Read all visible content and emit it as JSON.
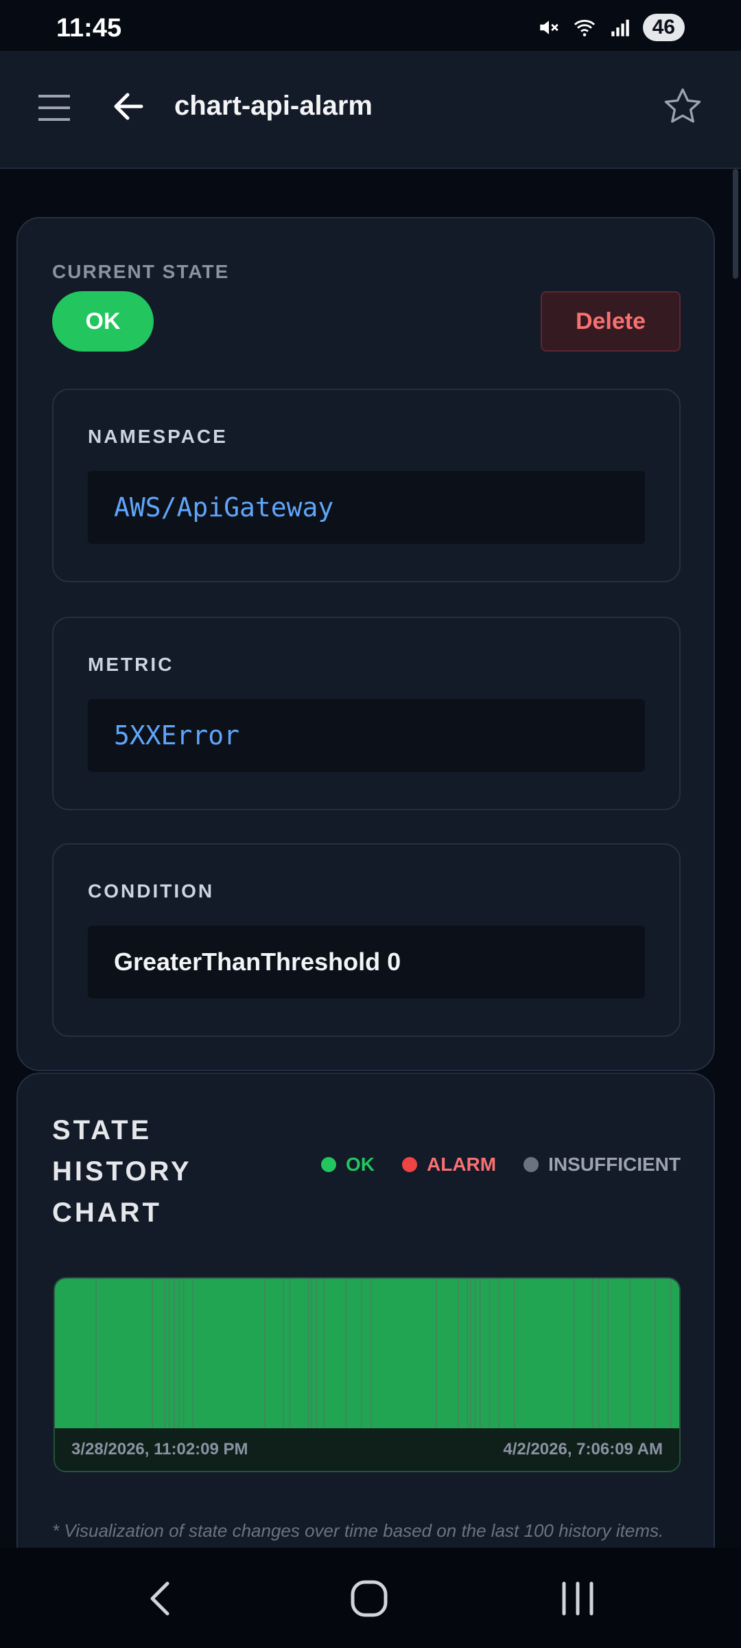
{
  "status_bar": {
    "time": "11:45",
    "battery": "46"
  },
  "app_bar": {
    "title": "chart-api-alarm"
  },
  "state_card": {
    "current_state_label": "CURRENT STATE",
    "state_value": "OK",
    "delete_label": "Delete",
    "fields": [
      {
        "label": "NAMESPACE",
        "value": "AWS/ApiGateway"
      },
      {
        "label": "METRIC",
        "value": "5XXError"
      },
      {
        "label": "CONDITION",
        "value": "GreaterThanThreshold 0"
      }
    ]
  },
  "chart_card": {
    "title": "STATE HISTORY CHART",
    "legend": [
      {
        "label": "OK",
        "color": "#22c55e"
      },
      {
        "label": "ALARM",
        "color": "#ef4444"
      },
      {
        "label": "INSUFFICIENT",
        "color": "#6b7280"
      }
    ],
    "start_label": "3/28/2026, 11:02:09 PM",
    "end_label": "4/2/2026, 7:06:09 AM",
    "note": "* Visualization of state changes over time based on the last 100 history items."
  },
  "chart_data": {
    "type": "bar",
    "title": "STATE HISTORY CHART",
    "x_range": [
      "3/28/2026, 11:02:09 PM",
      "4/2/2026, 7:06:09 AM"
    ],
    "states": [
      "OK"
    ],
    "series": [
      {
        "name": "OK",
        "color": "#22c55e",
        "coverage": 1.0
      }
    ],
    "transitions": [
      0.065,
      0.155,
      0.175,
      0.182,
      0.19,
      0.198,
      0.205,
      0.22,
      0.335,
      0.365,
      0.375,
      0.405,
      0.41,
      0.418,
      0.43,
      0.465,
      0.49,
      0.505,
      0.61,
      0.645,
      0.66,
      0.665,
      0.672,
      0.68,
      0.695,
      0.71,
      0.735,
      0.83,
      0.86,
      0.87,
      0.885,
      0.92,
      0.96,
      0.985
    ]
  },
  "icons": {
    "menu": "menu-icon",
    "back": "back-arrow-icon",
    "star": "star-icon",
    "mute": "mute-icon",
    "wifi": "wifi-icon",
    "signal": "signal-icon",
    "nav_back": "nav-back-icon",
    "nav_home": "nav-home-icon",
    "nav_recents": "nav-recents-icon"
  }
}
